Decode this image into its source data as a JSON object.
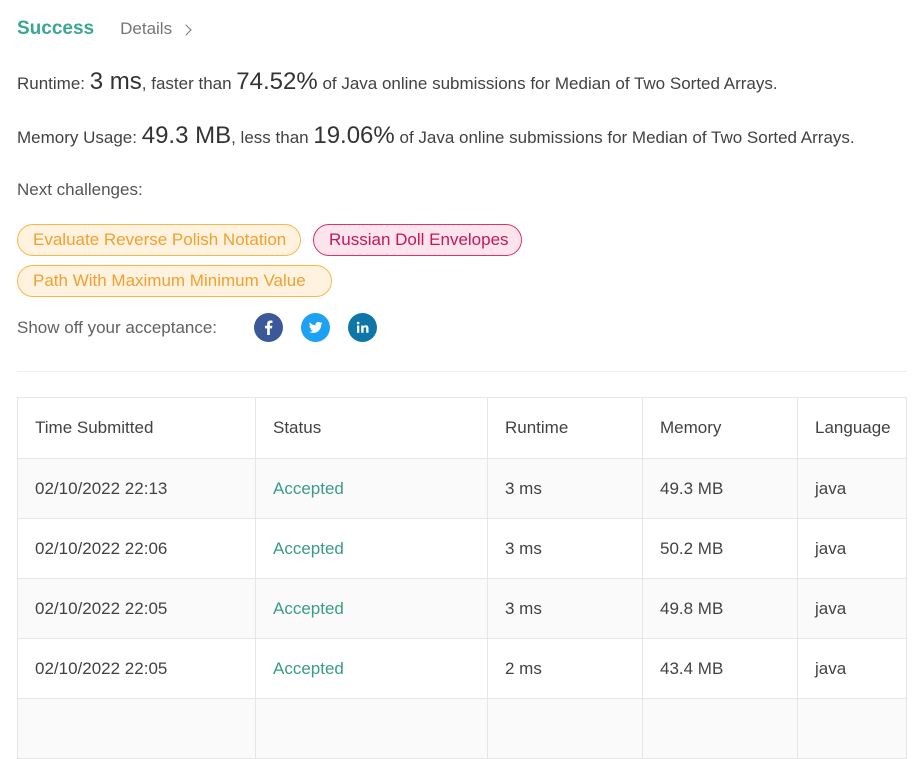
{
  "tabs": {
    "success": "Success",
    "details": "Details"
  },
  "runtime": {
    "label": "Runtime:",
    "value": "3 ms",
    "comparison": ", faster than",
    "percent": "74.52%",
    "suffix": "of Java online submissions for Median of Two Sorted Arrays."
  },
  "memory": {
    "label": "Memory Usage:",
    "value": "49.3 MB",
    "comparison": ", less than",
    "percent": "19.06%",
    "suffix": "of Java online submissions for Median of Two Sorted Arrays."
  },
  "next_challenges": {
    "label": "Next challenges:",
    "items": [
      {
        "label": "Evaluate Reverse Polish Notation",
        "difficulty_color": "#f0a030"
      },
      {
        "label": "Russian Doll Envelopes",
        "difficulty_color": "#c2185b"
      },
      {
        "label": "Path With Maximum Minimum Value",
        "difficulty_color": "#f0a030"
      }
    ]
  },
  "share": {
    "label": "Show off your acceptance:",
    "icons": [
      "facebook-icon",
      "twitter-icon",
      "linkedin-icon"
    ]
  },
  "table": {
    "headers": [
      "Time Submitted",
      "Status",
      "Runtime",
      "Memory",
      "Language"
    ],
    "rows": [
      [
        "02/10/2022 22:13",
        "Accepted",
        "3 ms",
        "49.3 MB",
        "java"
      ],
      [
        "02/10/2022 22:06",
        "Accepted",
        "3 ms",
        "50.2 MB",
        "java"
      ],
      [
        "02/10/2022 22:05",
        "Accepted",
        "3 ms",
        "49.8 MB",
        "java"
      ],
      [
        "02/10/2022 22:05",
        "Accepted",
        "2 ms",
        "43.4 MB",
        "java"
      ]
    ]
  },
  "colors": {
    "success": "#3aa693",
    "accepted": "#3a9b87"
  }
}
